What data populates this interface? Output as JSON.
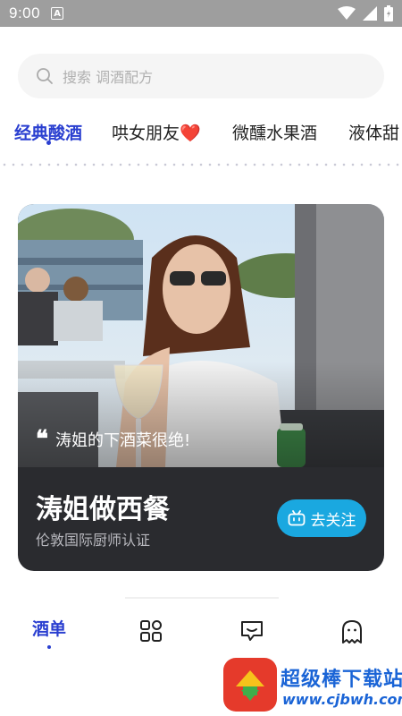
{
  "status_bar": {
    "time": "9:00",
    "notification_icon": "a-icon",
    "icons": [
      "wifi-icon",
      "signal-icon",
      "battery-icon"
    ]
  },
  "search": {
    "placeholder": "搜索 调酒配方",
    "icon": "search-icon"
  },
  "tabs": [
    {
      "label": "经典酸酒",
      "active": true
    },
    {
      "label": "哄女朋友❤️",
      "active": false
    },
    {
      "label": "微醺水果酒",
      "active": false
    },
    {
      "label": "液体甜",
      "active": false
    }
  ],
  "card": {
    "quote": "涛姐的下酒菜很绝!",
    "title": "涛姐做西餐",
    "subtitle": "伦敦国际厨师认证",
    "follow_label": "去关注",
    "follow_icon": "tv-icon"
  },
  "bottom_nav": {
    "items": [
      {
        "label": "酒单",
        "active": true
      },
      {
        "icon": "grid-icon"
      },
      {
        "icon": "message-icon"
      },
      {
        "icon": "ghost-icon"
      }
    ]
  },
  "watermark": {
    "text": "超级棒下载站",
    "url": "www.cjbwh.com"
  },
  "colors": {
    "accent": "#2a3fd0",
    "follow_button": "#1aa8e0",
    "card_bg": "#2a2b2f",
    "status_bar": "#9e9e9e"
  }
}
